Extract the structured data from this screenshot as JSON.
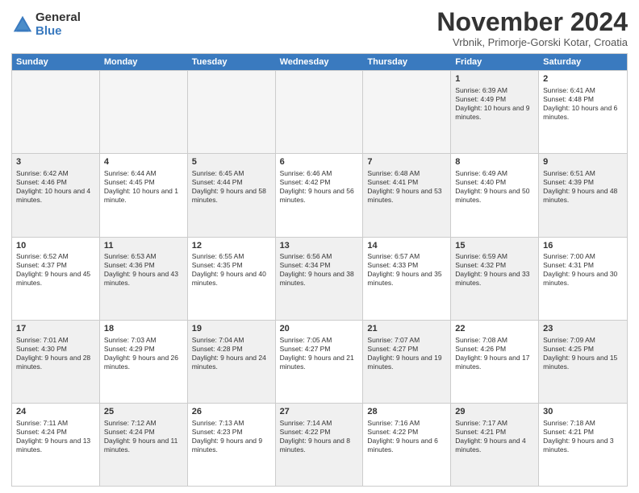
{
  "logo": {
    "general": "General",
    "blue": "Blue"
  },
  "title": "November 2024",
  "subtitle": "Vrbnik, Primorje-Gorski Kotar, Croatia",
  "header_days": [
    "Sunday",
    "Monday",
    "Tuesday",
    "Wednesday",
    "Thursday",
    "Friday",
    "Saturday"
  ],
  "rows": [
    [
      {
        "num": "",
        "info": "",
        "empty": true
      },
      {
        "num": "",
        "info": "",
        "empty": true
      },
      {
        "num": "",
        "info": "",
        "empty": true
      },
      {
        "num": "",
        "info": "",
        "empty": true
      },
      {
        "num": "",
        "info": "",
        "empty": true
      },
      {
        "num": "1",
        "info": "Sunrise: 6:39 AM\nSunset: 4:49 PM\nDaylight: 10 hours and 9 minutes.",
        "shaded": true
      },
      {
        "num": "2",
        "info": "Sunrise: 6:41 AM\nSunset: 4:48 PM\nDaylight: 10 hours and 6 minutes.",
        "shaded": false
      }
    ],
    [
      {
        "num": "3",
        "info": "Sunrise: 6:42 AM\nSunset: 4:46 PM\nDaylight: 10 hours and 4 minutes.",
        "shaded": true
      },
      {
        "num": "4",
        "info": "Sunrise: 6:44 AM\nSunset: 4:45 PM\nDaylight: 10 hours and 1 minute.",
        "shaded": false
      },
      {
        "num": "5",
        "info": "Sunrise: 6:45 AM\nSunset: 4:44 PM\nDaylight: 9 hours and 58 minutes.",
        "shaded": true
      },
      {
        "num": "6",
        "info": "Sunrise: 6:46 AM\nSunset: 4:42 PM\nDaylight: 9 hours and 56 minutes.",
        "shaded": false
      },
      {
        "num": "7",
        "info": "Sunrise: 6:48 AM\nSunset: 4:41 PM\nDaylight: 9 hours and 53 minutes.",
        "shaded": true
      },
      {
        "num": "8",
        "info": "Sunrise: 6:49 AM\nSunset: 4:40 PM\nDaylight: 9 hours and 50 minutes.",
        "shaded": false
      },
      {
        "num": "9",
        "info": "Sunrise: 6:51 AM\nSunset: 4:39 PM\nDaylight: 9 hours and 48 minutes.",
        "shaded": true
      }
    ],
    [
      {
        "num": "10",
        "info": "Sunrise: 6:52 AM\nSunset: 4:37 PM\nDaylight: 9 hours and 45 minutes.",
        "shaded": false
      },
      {
        "num": "11",
        "info": "Sunrise: 6:53 AM\nSunset: 4:36 PM\nDaylight: 9 hours and 43 minutes.",
        "shaded": true
      },
      {
        "num": "12",
        "info": "Sunrise: 6:55 AM\nSunset: 4:35 PM\nDaylight: 9 hours and 40 minutes.",
        "shaded": false
      },
      {
        "num": "13",
        "info": "Sunrise: 6:56 AM\nSunset: 4:34 PM\nDaylight: 9 hours and 38 minutes.",
        "shaded": true
      },
      {
        "num": "14",
        "info": "Sunrise: 6:57 AM\nSunset: 4:33 PM\nDaylight: 9 hours and 35 minutes.",
        "shaded": false
      },
      {
        "num": "15",
        "info": "Sunrise: 6:59 AM\nSunset: 4:32 PM\nDaylight: 9 hours and 33 minutes.",
        "shaded": true
      },
      {
        "num": "16",
        "info": "Sunrise: 7:00 AM\nSunset: 4:31 PM\nDaylight: 9 hours and 30 minutes.",
        "shaded": false
      }
    ],
    [
      {
        "num": "17",
        "info": "Sunrise: 7:01 AM\nSunset: 4:30 PM\nDaylight: 9 hours and 28 minutes.",
        "shaded": true
      },
      {
        "num": "18",
        "info": "Sunrise: 7:03 AM\nSunset: 4:29 PM\nDaylight: 9 hours and 26 minutes.",
        "shaded": false
      },
      {
        "num": "19",
        "info": "Sunrise: 7:04 AM\nSunset: 4:28 PM\nDaylight: 9 hours and 24 minutes.",
        "shaded": true
      },
      {
        "num": "20",
        "info": "Sunrise: 7:05 AM\nSunset: 4:27 PM\nDaylight: 9 hours and 21 minutes.",
        "shaded": false
      },
      {
        "num": "21",
        "info": "Sunrise: 7:07 AM\nSunset: 4:27 PM\nDaylight: 9 hours and 19 minutes.",
        "shaded": true
      },
      {
        "num": "22",
        "info": "Sunrise: 7:08 AM\nSunset: 4:26 PM\nDaylight: 9 hours and 17 minutes.",
        "shaded": false
      },
      {
        "num": "23",
        "info": "Sunrise: 7:09 AM\nSunset: 4:25 PM\nDaylight: 9 hours and 15 minutes.",
        "shaded": true
      }
    ],
    [
      {
        "num": "24",
        "info": "Sunrise: 7:11 AM\nSunset: 4:24 PM\nDaylight: 9 hours and 13 minutes.",
        "shaded": false
      },
      {
        "num": "25",
        "info": "Sunrise: 7:12 AM\nSunset: 4:24 PM\nDaylight: 9 hours and 11 minutes.",
        "shaded": true
      },
      {
        "num": "26",
        "info": "Sunrise: 7:13 AM\nSunset: 4:23 PM\nDaylight: 9 hours and 9 minutes.",
        "shaded": false
      },
      {
        "num": "27",
        "info": "Sunrise: 7:14 AM\nSunset: 4:22 PM\nDaylight: 9 hours and 8 minutes.",
        "shaded": true
      },
      {
        "num": "28",
        "info": "Sunrise: 7:16 AM\nSunset: 4:22 PM\nDaylight: 9 hours and 6 minutes.",
        "shaded": false
      },
      {
        "num": "29",
        "info": "Sunrise: 7:17 AM\nSunset: 4:21 PM\nDaylight: 9 hours and 4 minutes.",
        "shaded": true
      },
      {
        "num": "30",
        "info": "Sunrise: 7:18 AM\nSunset: 4:21 PM\nDaylight: 9 hours and 3 minutes.",
        "shaded": false
      }
    ]
  ]
}
